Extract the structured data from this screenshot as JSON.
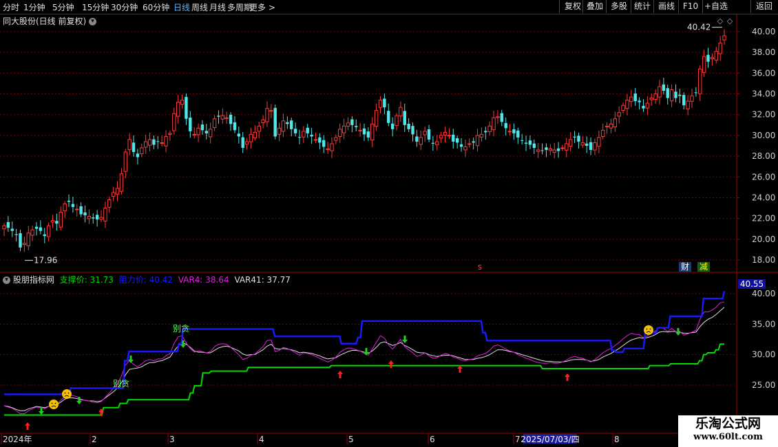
{
  "toolbar": {
    "periods": [
      "分时",
      "1分钟",
      "5分钟",
      "15分钟",
      "30分钟",
      "60分钟",
      "日线",
      "周线",
      "月线",
      "多周期",
      "更多 >"
    ],
    "active_period": "日线",
    "right_buttons": [
      "复权",
      "叠加",
      "多股",
      "统计",
      "画线",
      "F10",
      "+自选",
      "返回"
    ]
  },
  "main_panel": {
    "title": "同大股份(日线 前复权)",
    "max_label": "40.42",
    "min_label": "17.96",
    "marker_s": "s",
    "badge_cai": "财",
    "badge_jian": "减"
  },
  "indicator_panel": {
    "name": "股朋指标网",
    "support_label": "支撑价: 31.73",
    "resist_label": "阻力价: 40.42",
    "var4_label": "VAR4: 38.64",
    "var41_label": "VAR41: 37.77",
    "top_value": "40.55",
    "note1": "别贪",
    "note2": "别贪"
  },
  "xaxis": {
    "labels": [
      "2024年",
      "2",
      "3",
      "4",
      "5",
      "6",
      "7",
      "8"
    ],
    "date_box": "2025/07/03/四"
  },
  "watermark": {
    "title": "乐淘公式网",
    "url": "www.60lt.com"
  },
  "colors": {
    "up": "#ff3b3b",
    "down": "#4fe8ea",
    "support": "#00dd00",
    "resist": "#1a1aff",
    "var4": "#e020e0",
    "var41": "#e0e0e0",
    "grid": "#7a0000",
    "axis": "#a00000"
  },
  "chart_data": [
    {
      "type": "candlestick",
      "title": "同大股份(日线 前复权)",
      "ylim": [
        17,
        41
      ],
      "yticks": [
        18,
        20,
        22,
        24,
        26,
        28,
        30,
        32,
        34,
        36,
        38,
        40
      ],
      "closes": [
        21.3,
        21.1,
        20.8,
        20.4,
        19.2,
        19.6,
        20.6,
        20.9,
        21.0,
        20.8,
        20.3,
        21.3,
        21.8,
        21.5,
        22.6,
        23.4,
        23.6,
        23.1,
        22.9,
        22.4,
        22.3,
        22.2,
        22.0,
        21.9,
        22.1,
        23.0,
        23.8,
        24.5,
        24.9,
        26.3,
        28.4,
        29.6,
        28.4,
        27.9,
        28.8,
        29.4,
        29.6,
        29.1,
        29.4,
        29.3,
        29.9,
        30.2,
        32.1,
        33.2,
        33.4,
        31.6,
        30.4,
        30.1,
        30.7,
        30.5,
        30.2,
        30.6,
        31.6,
        31.8,
        31.9,
        31.7,
        31.1,
        30.5,
        29.9,
        28.8,
        29.4,
        30.1,
        30.3,
        30.9,
        31.5,
        32.6,
        32.4,
        29.9,
        30.7,
        31.4,
        31.1,
        30.6,
        30.2,
        29.8,
        30.4,
        30.2,
        29.9,
        29.6,
        29.3,
        28.9,
        28.7,
        29.2,
        29.8,
        30.6,
        30.9,
        31.2,
        31.0,
        30.8,
        30.5,
        30.1,
        29.8,
        31.1,
        32.4,
        33.4,
        32.7,
        31.2,
        30.6,
        31.9,
        32.7,
        31.0,
        30.6,
        30.1,
        29.4,
        29.8,
        30.4,
        29.6,
        29.2,
        29.4,
        30.0,
        30.3,
        30.0,
        29.4,
        29.3,
        28.9,
        28.9,
        29.2,
        29.3,
        30.0,
        30.1,
        30.3,
        30.9,
        31.7,
        31.8,
        31.3,
        30.7,
        30.4,
        30.2,
        29.8,
        29.5,
        29.2,
        29.1,
        28.8,
        28.6,
        28.5,
        28.6,
        28.7,
        28.6,
        28.5,
        28.8,
        29.2,
        29.6,
        29.8,
        29.4,
        29.3,
        29.0,
        28.6,
        29.3,
        29.8,
        30.5,
        30.9,
        31.1,
        31.6,
        32.2,
        32.9,
        33.4,
        33.7,
        33.3,
        33.2,
        32.6,
        33.1,
        33.6,
        34.0,
        34.7,
        34.3,
        33.6,
        34.4,
        33.6,
        33.8,
        32.9,
        33.3,
        33.8,
        34.1,
        36.4,
        37.6,
        37.1,
        37.5,
        38.1,
        38.9,
        39.6
      ]
    },
    {
      "type": "line",
      "title": "股朋指标网",
      "ylim": [
        20,
        41
      ],
      "yticks": [
        25,
        30,
        35,
        40
      ],
      "series": [
        {
          "name": "VAR41",
          "values": [
            21.6,
            21.5,
            21.3,
            21.0,
            20.8,
            20.8,
            21.1,
            21.3,
            21.5,
            21.4,
            21.3,
            21.5,
            21.7,
            21.8,
            22.2,
            22.7,
            22.9,
            22.9,
            22.8,
            22.6,
            22.5,
            22.4,
            22.4,
            22.3,
            22.4,
            22.9,
            23.4,
            23.9,
            24.5,
            25.4,
            26.7,
            27.6,
            27.7,
            27.8,
            28.0,
            28.4,
            28.7,
            28.7,
            28.9,
            29.0,
            29.3,
            29.6,
            30.6,
            31.4,
            32.0,
            31.7,
            31.2,
            30.6,
            30.4,
            30.4,
            30.3,
            30.3,
            30.7,
            31.1,
            31.3,
            31.4,
            31.2,
            30.9,
            30.6,
            30.1,
            29.9,
            30.0,
            30.0,
            30.4,
            30.8,
            31.4,
            31.7,
            31.0,
            30.9,
            31.0,
            30.9,
            30.8,
            30.6,
            30.3,
            30.4,
            30.3,
            30.2,
            30.0,
            29.8,
            29.5,
            29.3,
            29.4,
            29.5,
            29.9,
            30.2,
            30.5,
            30.7,
            30.7,
            30.6,
            30.4,
            30.2,
            30.6,
            31.2,
            31.9,
            32.1,
            31.8,
            31.5,
            31.7,
            32.0,
            31.5,
            31.2,
            30.8,
            30.4,
            30.3,
            30.3,
            30.0,
            29.8,
            29.7,
            29.8,
            29.9,
            29.9,
            29.8,
            29.6,
            29.4,
            29.2,
            29.2,
            29.2,
            29.4,
            29.5,
            29.7,
            30.0,
            30.4,
            30.8,
            30.8,
            30.7,
            30.5,
            30.4,
            30.2,
            30.0,
            29.8,
            29.6,
            29.4,
            29.2,
            29.0,
            28.9,
            28.9,
            28.8,
            28.8,
            28.8,
            28.9,
            29.1,
            29.2,
            29.2,
            29.2,
            29.1,
            28.9,
            29.0,
            29.2,
            29.6,
            29.9,
            30.2,
            30.6,
            31.0,
            31.5,
            32.0,
            32.4,
            32.6,
            32.8,
            32.7,
            32.8,
            33.0,
            33.3,
            33.7,
            33.8,
            33.7,
            33.8,
            33.8,
            33.7,
            33.5,
            33.5,
            33.6,
            33.7,
            34.6,
            35.3,
            35.8,
            36.1,
            36.6,
            37.2,
            37.77
          ]
        },
        {
          "name": "VAR4",
          "values": [
            21.6,
            21.4,
            21.2,
            20.8,
            20.3,
            20.3,
            20.8,
            21.1,
            21.4,
            21.3,
            21.1,
            21.5,
            21.9,
            21.9,
            22.5,
            23.1,
            23.4,
            23.3,
            23.1,
            22.7,
            22.5,
            22.4,
            22.2,
            22.1,
            22.3,
            23.0,
            23.7,
            24.5,
            25.2,
            26.5,
            28.3,
            29.0,
            28.4,
            28.0,
            28.5,
            29.0,
            29.2,
            29.0,
            29.3,
            29.3,
            29.8,
            30.2,
            31.8,
            32.9,
            33.1,
            31.9,
            31.0,
            30.4,
            30.6,
            30.5,
            30.3,
            30.5,
            31.3,
            31.7,
            31.8,
            31.7,
            31.2,
            30.6,
            30.0,
            29.2,
            29.4,
            29.9,
            30.1,
            30.7,
            31.3,
            32.3,
            32.4,
            30.5,
            30.7,
            31.2,
            31.0,
            30.7,
            30.3,
            29.9,
            30.3,
            30.2,
            30.0,
            29.7,
            29.4,
            29.1,
            28.8,
            29.1,
            29.6,
            30.4,
            30.8,
            31.1,
            31.0,
            30.8,
            30.6,
            30.2,
            29.9,
            30.9,
            32.0,
            33.1,
            32.7,
            31.6,
            30.9,
            31.7,
            32.5,
            31.3,
            30.8,
            30.3,
            29.7,
            29.9,
            30.3,
            29.8,
            29.4,
            29.5,
            29.9,
            30.2,
            30.0,
            29.6,
            29.4,
            29.1,
            29.0,
            29.2,
            29.3,
            29.8,
            30.0,
            30.2,
            30.7,
            31.4,
            31.6,
            31.3,
            30.9,
            30.6,
            30.4,
            30.0,
            29.7,
            29.4,
            29.2,
            28.9,
            28.7,
            28.6,
            28.6,
            28.7,
            28.6,
            28.6,
            28.8,
            29.1,
            29.5,
            29.7,
            29.5,
            29.4,
            29.1,
            28.8,
            29.2,
            29.7,
            30.3,
            30.7,
            31.0,
            31.5,
            32.0,
            32.6,
            33.1,
            33.5,
            33.3,
            33.3,
            32.8,
            33.1,
            33.5,
            33.9,
            34.5,
            34.3,
            33.8,
            34.3,
            33.8,
            33.8,
            33.2,
            33.4,
            33.7,
            34.0,
            35.8,
            37.0,
            37.0,
            37.3,
            37.8,
            38.5,
            38.64
          ]
        },
        {
          "name": "支撑价",
          "values": [
            20.1,
            20.1,
            20.1,
            20.1,
            20.1,
            20.1,
            20.1,
            20.1,
            20.1,
            20.1,
            20.1,
            20.1,
            20.1,
            20.1,
            20.1,
            20.1,
            20.1,
            20.1,
            20.1,
            20.1,
            20.1,
            20.1,
            20.1,
            20.1,
            21.3,
            21.3,
            21.3,
            21.3,
            22.0,
            22.0,
            22.6,
            22.6,
            22.6,
            22.6,
            22.6,
            22.6,
            22.6,
            22.6,
            22.6,
            22.6,
            22.6,
            22.6,
            22.6,
            22.6,
            22.6,
            23.7,
            24.9,
            24.9,
            27.0,
            27.0,
            27.3,
            27.3,
            27.3,
            27.3,
            27.3,
            27.3,
            27.3,
            27.3,
            27.3,
            27.9,
            27.9,
            27.9,
            27.9,
            27.9,
            27.9,
            27.9,
            27.9,
            27.9,
            27.9,
            27.9,
            27.9,
            27.9,
            27.9,
            27.9,
            27.9,
            27.9,
            27.9,
            27.9,
            27.9,
            28.2,
            28.2,
            28.2,
            28.2,
            28.2,
            28.2,
            28.2,
            28.2,
            28.2,
            28.2,
            28.2,
            28.2,
            28.2,
            28.2,
            28.2,
            28.2,
            28.2,
            28.2,
            28.2,
            28.2,
            28.2,
            28.2,
            28.2,
            28.2,
            28.2,
            28.2,
            28.2,
            28.2,
            28.2,
            28.2,
            28.2,
            28.2,
            28.2,
            28.2,
            28.2,
            28.2,
            28.2,
            28.2,
            28.2,
            28.2,
            28.2,
            28.2,
            28.2,
            28.2,
            28.2,
            28.2,
            28.2,
            28.2,
            28.2,
            28.2,
            28.2,
            27.7,
            27.7,
            27.7,
            27.7,
            27.7,
            27.7,
            27.7,
            27.7,
            27.7,
            27.7,
            27.7,
            27.7,
            27.7,
            27.7,
            27.7,
            27.7,
            27.7,
            27.7,
            27.7,
            27.7,
            27.7,
            27.7,
            27.7,
            27.7,
            27.7,
            27.7,
            28.2,
            28.2,
            28.2,
            28.2,
            28.2,
            28.5,
            28.5,
            28.5,
            28.5,
            28.5,
            28.5,
            28.5,
            29.0,
            30.0,
            30.3,
            30.3,
            30.8,
            31.73,
            31.73
          ]
        },
        {
          "name": "阻力价",
          "values": [
            23.5,
            23.5,
            23.5,
            23.5,
            23.5,
            23.5,
            23.5,
            23.5,
            23.5,
            23.5,
            23.5,
            23.5,
            23.5,
            23.5,
            23.5,
            23.5,
            24.5,
            24.5,
            24.5,
            24.5,
            24.5,
            24.5,
            24.5,
            24.5,
            24.5,
            24.5,
            24.5,
            24.5,
            24.5,
            29.0,
            30.5,
            30.5,
            30.5,
            30.5,
            30.5,
            30.5,
            30.5,
            30.5,
            30.5,
            30.5,
            30.5,
            30.5,
            31.8,
            34.2,
            34.2,
            34.2,
            34.2,
            34.2,
            34.2,
            34.2,
            34.2,
            34.2,
            34.2,
            34.2,
            34.2,
            34.2,
            34.2,
            34.2,
            34.2,
            34.2,
            34.2,
            34.2,
            34.2,
            34.2,
            34.2,
            33.0,
            33.0,
            33.0,
            33.0,
            33.0,
            33.0,
            33.0,
            33.0,
            33.0,
            33.0,
            33.0,
            33.0,
            33.0,
            33.0,
            33.0,
            33.0,
            31.8,
            31.8,
            31.8,
            31.8,
            32.8,
            35.5,
            35.5,
            35.5,
            35.5,
            35.5,
            35.5,
            35.5,
            35.5,
            35.5,
            35.5,
            35.5,
            35.5,
            35.5,
            35.5,
            35.5,
            35.5,
            35.5,
            35.5,
            35.5,
            35.5,
            35.5,
            35.5,
            35.5,
            35.5,
            35.5,
            35.5,
            35.5,
            35.5,
            35.5,
            33.6,
            32.3,
            32.3,
            32.3,
            32.3,
            32.3,
            32.3,
            32.3,
            32.3,
            32.3,
            32.3,
            32.3,
            32.3,
            32.3,
            32.3,
            32.3,
            32.3,
            32.3,
            32.3,
            32.3,
            32.3,
            32.3,
            32.3,
            32.3,
            32.3,
            32.3,
            32.3,
            32.3,
            32.3,
            32.3,
            32.3,
            30.7,
            30.4,
            30.4,
            31.0,
            31.0,
            31.0,
            31.0,
            31.0,
            33.6,
            33.6,
            33.6,
            34.4,
            34.4,
            34.4,
            36.3,
            36.3,
            36.3,
            36.3,
            36.3,
            36.3,
            36.3,
            36.3,
            39.2,
            39.2,
            39.2,
            39.2,
            39.2,
            40.42
          ]
        }
      ]
    }
  ]
}
